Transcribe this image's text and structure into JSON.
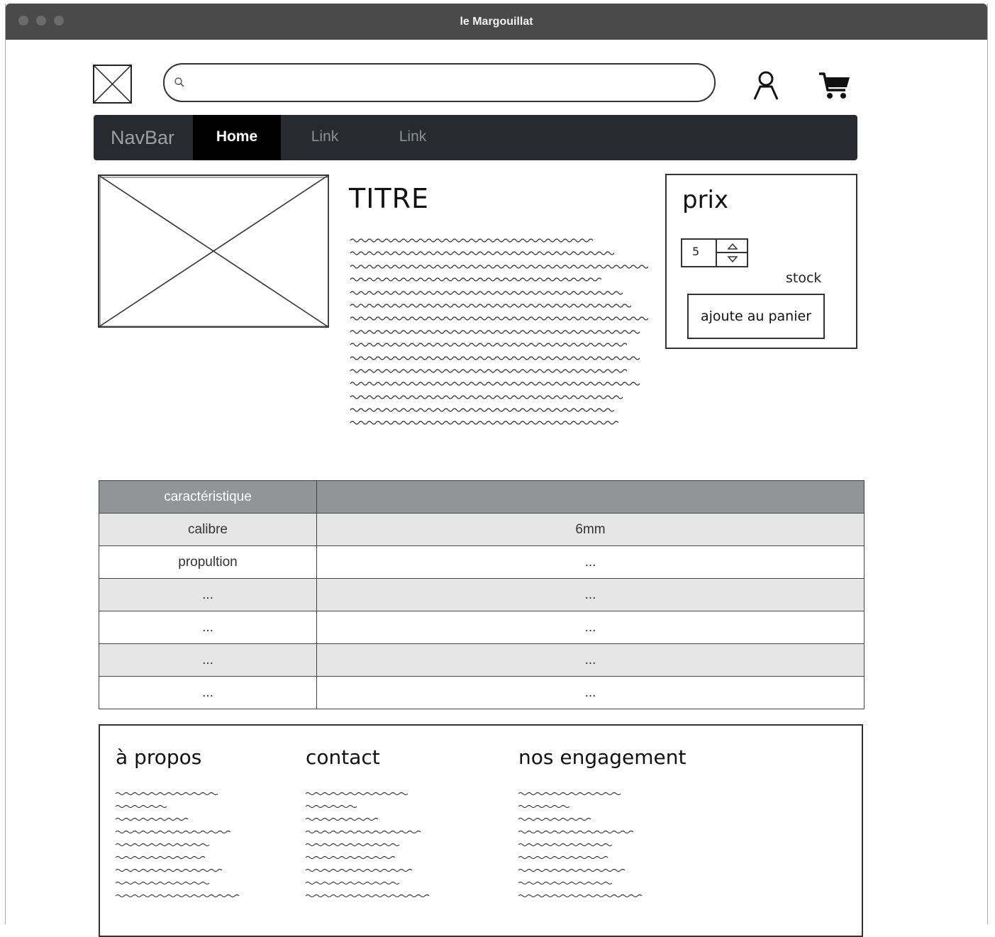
{
  "window": {
    "title": "le Margouillat"
  },
  "header": {
    "search": {
      "placeholder": "",
      "value": ""
    },
    "icons": [
      "user-icon",
      "cart-icon"
    ]
  },
  "navbar": {
    "brand": "NavBar",
    "items": [
      {
        "label": "Home",
        "active": true
      },
      {
        "label": "Link",
        "active": false
      },
      {
        "label": "Link",
        "active": false
      }
    ]
  },
  "product": {
    "title": "TITRE",
    "price_label": "prix",
    "quantity": "5",
    "stock_label": "stock",
    "add_to_cart_label": "ajoute au panier"
  },
  "specs": {
    "headers": [
      "caractéristique",
      ""
    ],
    "rows": [
      [
        "calibre",
        "6mm"
      ],
      [
        "propultion",
        "..."
      ],
      [
        "...",
        "..."
      ],
      [
        "...",
        "..."
      ],
      [
        "...",
        "..."
      ],
      [
        "...",
        "..."
      ]
    ]
  },
  "footer": {
    "columns": [
      {
        "heading": "à propos"
      },
      {
        "heading": "contact"
      },
      {
        "heading": "nos engagement"
      }
    ]
  }
}
